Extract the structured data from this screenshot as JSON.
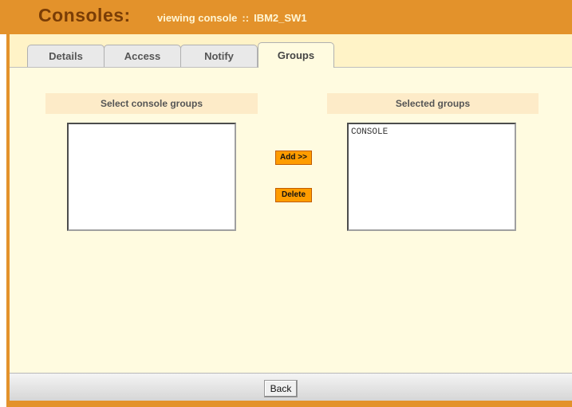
{
  "header": {
    "title": "Consoles:",
    "subtitle_prefix": "viewing console",
    "subtitle_sep": "::",
    "console_name": "IBM2_SW1"
  },
  "tabs": [
    {
      "label": "Details",
      "active": false
    },
    {
      "label": "Access",
      "active": false
    },
    {
      "label": "Notify",
      "active": false
    },
    {
      "label": "Groups",
      "active": true
    }
  ],
  "groups": {
    "available_heading": "Select console groups",
    "selected_heading": "Selected groups",
    "available_items": [],
    "selected_items": [
      "CONSOLE"
    ],
    "add_label": "Add >>",
    "delete_label": "Delete"
  },
  "footer": {
    "back_label": "Back"
  },
  "colors": {
    "header_bg": "#e3922b",
    "panel_bg": "#fffbe0",
    "button_bg": "#ff9c00"
  }
}
